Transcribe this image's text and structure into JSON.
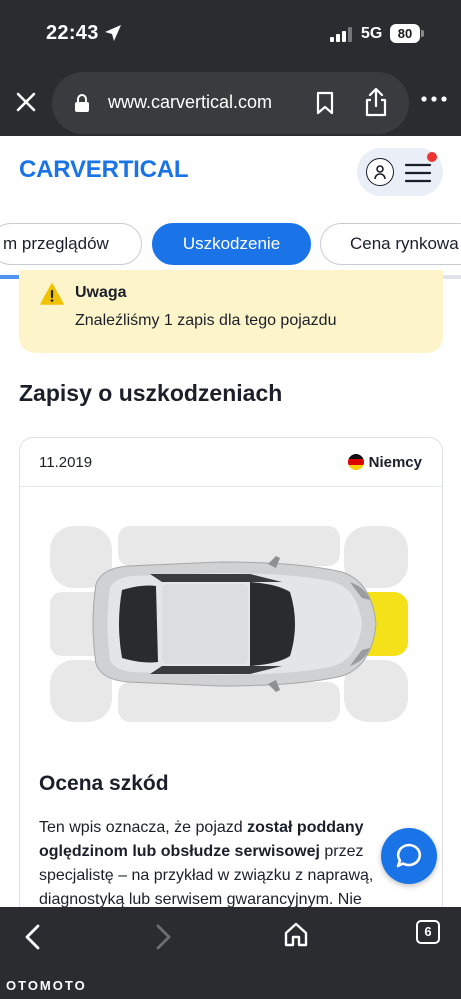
{
  "status": {
    "time": "22:43",
    "network": "5G",
    "battery": "80"
  },
  "browser": {
    "url": "www.carvertical.com"
  },
  "site": {
    "logo_text": "CARVERTICAL",
    "brand_color": "#1a74e8"
  },
  "tabs": [
    {
      "label": "m przeglądów",
      "active": false
    },
    {
      "label": "Uszkodzenie",
      "active": true
    },
    {
      "label": "Cena rynkowa",
      "active": false
    }
  ],
  "warning": {
    "title": "Uwaga",
    "text": "Znaleźliśmy 1 zapis dla tego pojazdu"
  },
  "section_title": "Zapisy o uszkodzeniach",
  "record": {
    "date": "11.2019",
    "country": "Niemcy",
    "damaged_zone": "front",
    "damage_color": "#f4e11a",
    "damage_title": "Ocena szkód",
    "damage_text_1": "Ten wpis oznacza, że pojazd ",
    "damage_text_bold": "został poddany oględzinom lub obsłudze serwisowej",
    "damage_text_2": " przez specjalistę – na przykład w związku z naprawą, diagnostyką lub serwisem gwarancyjnym. Nie"
  },
  "bottom_nav": {
    "tab_count": "6",
    "watermark": "OTOMOTO"
  }
}
